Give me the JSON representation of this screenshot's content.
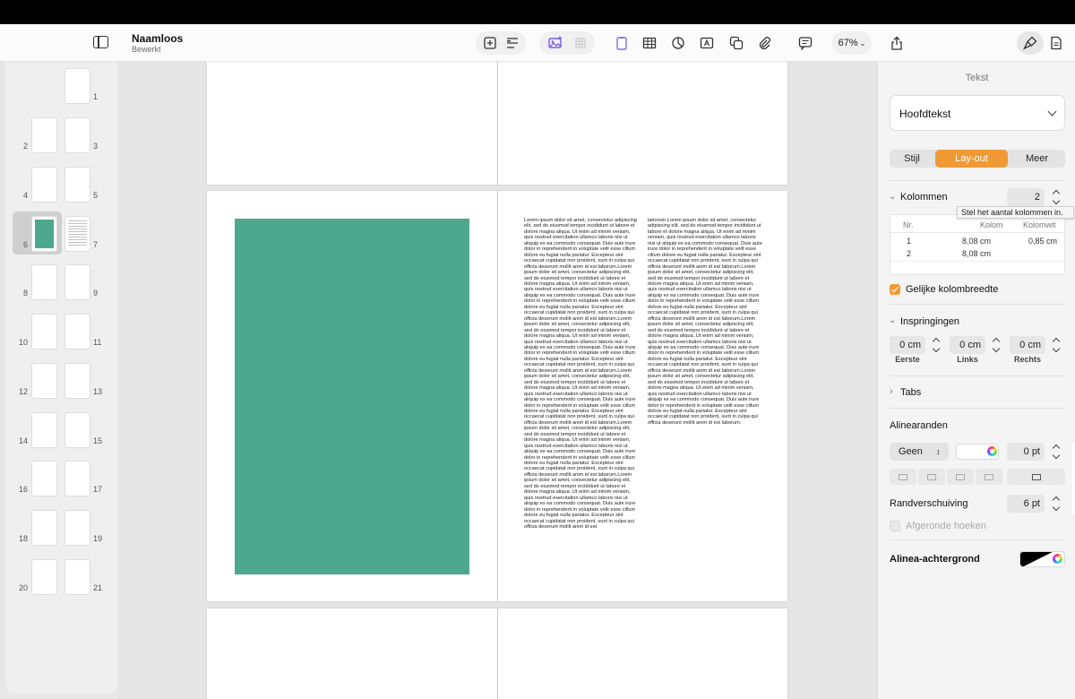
{
  "document": {
    "title": "Naamloos",
    "status": "Bewerkt"
  },
  "toolbar": {
    "zoom": "67%",
    "icons": [
      "sidebar-icon",
      "add-page-icon",
      "text-list-icon",
      "media-icon",
      "grid-icon",
      "doc-icon",
      "table-icon",
      "chart-icon",
      "text-box-icon",
      "shape-icon",
      "attachment-icon",
      "comment-icon",
      "share-icon",
      "format-brush-icon",
      "document-icon"
    ]
  },
  "thumbnails": {
    "pages": [
      "1",
      "2",
      "3",
      "4",
      "5",
      "6",
      "7",
      "8",
      "9",
      "10",
      "11",
      "12",
      "13",
      "14",
      "15",
      "16",
      "17",
      "18",
      "19",
      "20",
      "21"
    ],
    "selected": "6"
  },
  "canvas": {
    "accent_color": "#4ea88e",
    "text_col1": "Lorem ipsum dolor sit amet, consectetur adipiscing elit, sed do eiusmod tempor incididunt ut labore et dolore magna aliqua. Ut enim ad minim veniam, quis nostrud exercitation ullamco laboris nisi ut aliquip ex ea commodo consequat. Duis aute irure dolor in reprehenderit in voluptate velit esse cillum dolore eu fugiat nulla pariatur. Excepteur sint occaecat cupidatat non proident, sunt in culpa qui officia deserunt mollit anim id est laborum.Lorem ipsum dolor sit amet, consectetur adipiscing elit, sed do eiusmod tempor incididunt ut labore et dolore magna aliqua. Ut enim ad minim veniam, quis nostrud exercitation ullamco laboris nisi ut aliquip ex ea commodo consequat. Duis aute irure dolor in reprehenderit in voluptate velit esse cillum dolore eu fugiat nulla pariatur. Excepteur sint occaecat cupidatat non proident, sunt in culpa qui officia deserunt mollit anim id est laborum.Lorem ipsum dolor sit amet, consectetur adipiscing elit, sed do eiusmod tempor incididunt ut labore et dolore magna aliqua. Ut enim ad minim veniam, quis nostrud exercitation ullamco laboris nisi ut aliquip ex ea commodo consequat. Duis aute irure dolor in reprehenderit in voluptate velit esse cillum dolore eu fugiat nulla pariatur. Excepteur sint occaecat cupidatat non proident, sunt in culpa qui officia deserunt mollit anim id est laborum.Lorem ipsum dolor sit amet, consectetur adipiscing elit, sed do eiusmod tempor incididunt ut labore et dolore magna aliqua. Ut enim ad minim veniam, quis nostrud exercitation ullamco laboris nisi ut aliquip ex ea commodo consequat. Duis aute irure dolor in reprehenderit in voluptate velit esse cillum dolore eu fugiat nulla pariatur. Excepteur sint occaecat cupidatat non proident, sunt in culpa qui officia deserunt mollit anim id est laborum.Lorem ipsum dolor sit amet, consectetur adipiscing elit, sed do eiusmod tempor incididunt ut labore et dolore magna aliqua. Ut enim ad minim veniam, quis nostrud exercitation ullamco laboris nisi ut aliquip ex ea commodo consequat. Duis aute irure dolor in reprehenderit in voluptate velit esse cillum dolore eu fugiat nulla pariatur. Excepteur sint occaecat cupidatat non proident, sunt in culpa qui officia deserunt mollit anim id est laborum.Lorem ipsum dolor sit amet, consectetur adipiscing elit, sed do eiusmod tempor incididunt ut labore et dolore magna aliqua. Ut enim ad minim veniam, quis nostrud exercitation ullamco laboris nisi ut aliquip ex ea commodo consequat. Duis aute irure dolor in reprehenderit in voluptate velit esse cillum dolore eu fugiat nulla pariatur. Excepteur sint occaecat cupidatat non proident, sunt in culpa qui officia deserunt mollit anim id est",
    "text_col2": "laborum.Lorem ipsum dolor sit amet, consectetur adipiscing elit, sed do eiusmod tempor incididunt ut labore et dolore magna aliqua. Ut enim ad minim veniam, quis nostrud exercitation ullamco laboris nisi ut aliquip ex ea commodo consequat. Duis aute irure dolor in reprehenderit in voluptate velit esse cillum dolore eu fugiat nulla pariatur. Excepteur sint occaecat cupidatat non proident, sunt in culpa qui officia deserunt mollit anim id est laborum.Lorem ipsum dolor sit amet, consectetur adipiscing elit, sed do eiusmod tempor incididunt ut labore et dolore magna aliqua. Ut enim ad minim veniam, quis nostrud exercitation ullamco laboris nisi ut aliquip ex ea commodo consequat. Duis aute irure dolor in reprehenderit in voluptate velit esse cillum dolore eu fugiat nulla pariatur. Excepteur sint occaecat cupidatat non proident, sunt in culpa qui officia deserunt mollit anim id est laborum.Lorem ipsum dolor sit amet, consectetur adipiscing elit, sed do eiusmod tempor incididunt ut labore et dolore magna aliqua. Ut enim ad minim veniam, quis nostrud exercitation ullamco laboris nisi ut aliquip ex ea commodo consequat. Duis aute irure dolor in reprehenderit in voluptate velit esse cillum dolore eu fugiat nulla pariatur. Excepteur sint occaecat cupidatat non proident, sunt in culpa qui officia deserunt mollit anim id est laborum.Lorem ipsum dolor sit amet, consectetur adipiscing elit, sed do eiusmod tempor incididunt ut labore et dolore magna aliqua. Ut enim ad minim veniam, quis nostrud exercitation ullamco laboris nisi ut aliquip ex ea commodo consequat. Duis aute irure dolor in reprehenderit in voluptate velit esse cillum dolore eu fugiat nulla pariatur. Excepteur sint occaecat cupidatat non proident, sunt in culpa qui officia deserunt mollit anim id est laborum."
  },
  "inspector": {
    "title": "Tekst",
    "paragraph_style": "Hoofdtekst",
    "tabs": {
      "style": "Stijl",
      "layout": "Lay-out",
      "more": "Meer",
      "active": "Lay-out"
    },
    "columns": {
      "label": "Kolommen",
      "count": "2",
      "tooltip": "Stel het aantal kolommen in.",
      "headers": {
        "nr": "Nr.",
        "column": "Kolom",
        "gap": "Kolomwit"
      },
      "rows": [
        {
          "nr": "1",
          "column": "8,08 cm",
          "gap": "0,85 cm"
        },
        {
          "nr": "2",
          "column": "8,08 cm",
          "gap": ""
        }
      ],
      "equal_width_label": "Gelijke kolombreedte",
      "equal_width_checked": true
    },
    "indents": {
      "label": "Inspringingen",
      "first": {
        "value": "0 cm",
        "label": "Eerste"
      },
      "left": {
        "value": "0 cm",
        "label": "Links"
      },
      "right": {
        "value": "0 cm",
        "label": "Rechts"
      }
    },
    "tabs_section": {
      "label": "Tabs"
    },
    "borders": {
      "label": "Alinearanden",
      "style": "Geen",
      "width": "0 pt",
      "offset_label": "Randverschuiving",
      "offset": "6 pt",
      "rounded_label": "Afgeronde hoeken",
      "rounded_checked": false
    },
    "background": {
      "label": "Alinea-achtergrond"
    },
    "accent_color": "#f09a36"
  }
}
